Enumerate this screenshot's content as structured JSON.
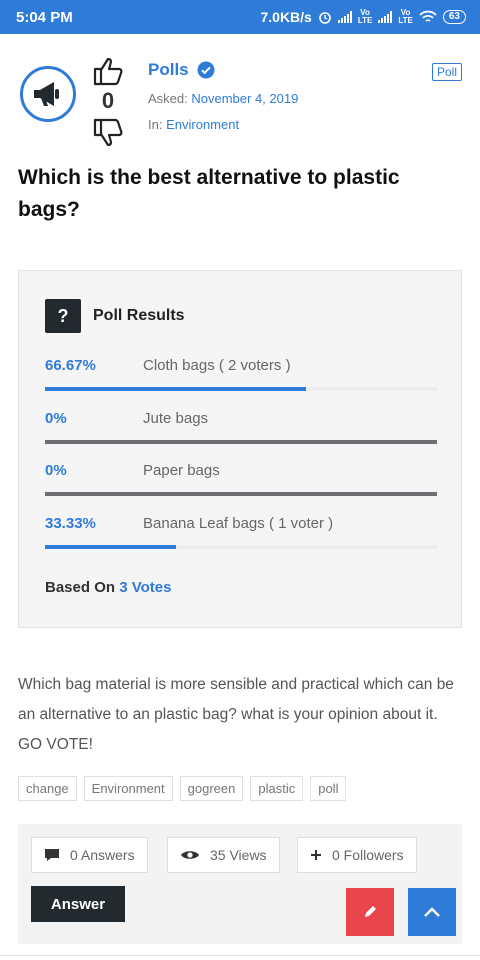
{
  "status_bar": {
    "time": "5:04 PM",
    "speed": "7.0KB/s",
    "lte_label": "Vo\nLTE",
    "battery": "63"
  },
  "post": {
    "category_tag": "Poll",
    "vote_count": "0",
    "author_name": "Polls",
    "asked_prefix": "Asked:",
    "asked_date": "November 4, 2019",
    "in_prefix": "In:",
    "in_category": "Environment",
    "question": "Which is the best alternative to plastic bags?"
  },
  "poll": {
    "badge": "?",
    "title": "Poll Results",
    "options": [
      {
        "percent": "66.67%",
        "label": "Cloth bags ( 2 voters )",
        "fill": 0.667
      },
      {
        "percent": "0%",
        "label": "Jute bags",
        "fill": 0
      },
      {
        "percent": "0%",
        "label": "Paper bags",
        "fill": 0
      },
      {
        "percent": "33.33%",
        "label": "Banana Leaf bags ( 1 voter )",
        "fill": 0.333
      }
    ],
    "based_on_prefix": "Based On",
    "votes_label": "3 Votes"
  },
  "description": "Which bag material is more sensible and practical which can be an alternative to an plastic bag? what is your opinion about it. GO VOTE!",
  "tags": [
    "change",
    "Environment",
    "gogreen",
    "plastic",
    "poll"
  ],
  "footer": {
    "answers": "0 Answers",
    "views": "35 Views",
    "followers": "0 Followers",
    "answer_button": "Answer"
  },
  "colors": {
    "accent": "#2f7bd8",
    "dark": "#222a30",
    "edit": "#e8464c"
  },
  "icons": {
    "avatar": "megaphone-icon",
    "upvote": "thumbs-up-icon",
    "downvote": "thumbs-down-icon",
    "verified": "verified-badge-icon",
    "answers": "comment-icon",
    "views": "eye-icon",
    "followers": "plus-icon",
    "edit": "pencil-icon",
    "scroll_top": "chevron-up-icon"
  }
}
